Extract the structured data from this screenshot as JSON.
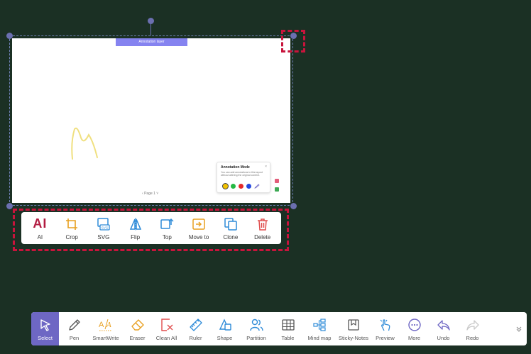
{
  "canvas": {
    "tag_label": "Annotation layer",
    "page_label": "Page 1"
  },
  "annotation_popup": {
    "title": "Annotation Mode",
    "close": "×",
    "description": "You can add annotations in this layout without altering the original content.",
    "colors": [
      "#f2c200",
      "#25b843",
      "#e42929",
      "#2448e0"
    ]
  },
  "context_toolbar": {
    "items": [
      {
        "icon": "ai-icon",
        "label": "AI",
        "glyph": "AI"
      },
      {
        "icon": "crop-icon",
        "label": "Crop"
      },
      {
        "icon": "svg-icon",
        "label": "SVG"
      },
      {
        "icon": "flip-icon",
        "label": "Flip"
      },
      {
        "icon": "top-icon",
        "label": "Top"
      },
      {
        "icon": "move-to-icon",
        "label": "Move to"
      },
      {
        "icon": "clone-icon",
        "label": "Clone"
      },
      {
        "icon": "delete-icon",
        "label": "Delete"
      }
    ],
    "accent_colors": {
      "ai": "#b21b41",
      "crop": "#e8a020",
      "blue": "#2e8bd8",
      "delete": "#e04d4d"
    }
  },
  "main_toolbar": {
    "items": [
      {
        "icon": "cursor-icon",
        "label": "Select"
      },
      {
        "icon": "pen-icon",
        "label": "Pen"
      },
      {
        "icon": "smartwrite-icon",
        "label": "SmartWrite"
      },
      {
        "icon": "eraser-icon",
        "label": "Eraser"
      },
      {
        "icon": "clean-all-icon",
        "label": "Clean All"
      },
      {
        "icon": "ruler-icon",
        "label": "Ruler"
      },
      {
        "icon": "shape-icon",
        "label": "Shape"
      },
      {
        "icon": "partition-icon",
        "label": "Partition"
      },
      {
        "icon": "table-icon",
        "label": "Table"
      },
      {
        "icon": "mind-map-icon",
        "label": "Mind map"
      },
      {
        "icon": "sticky-notes-icon",
        "label": "Sticky-Notes"
      },
      {
        "icon": "preview-icon",
        "label": "Preview"
      },
      {
        "icon": "more-icon",
        "label": "More"
      },
      {
        "icon": "undo-icon",
        "label": "Undo"
      },
      {
        "icon": "redo-icon",
        "label": "Redo"
      }
    ],
    "active_color": "#6e67c4"
  }
}
